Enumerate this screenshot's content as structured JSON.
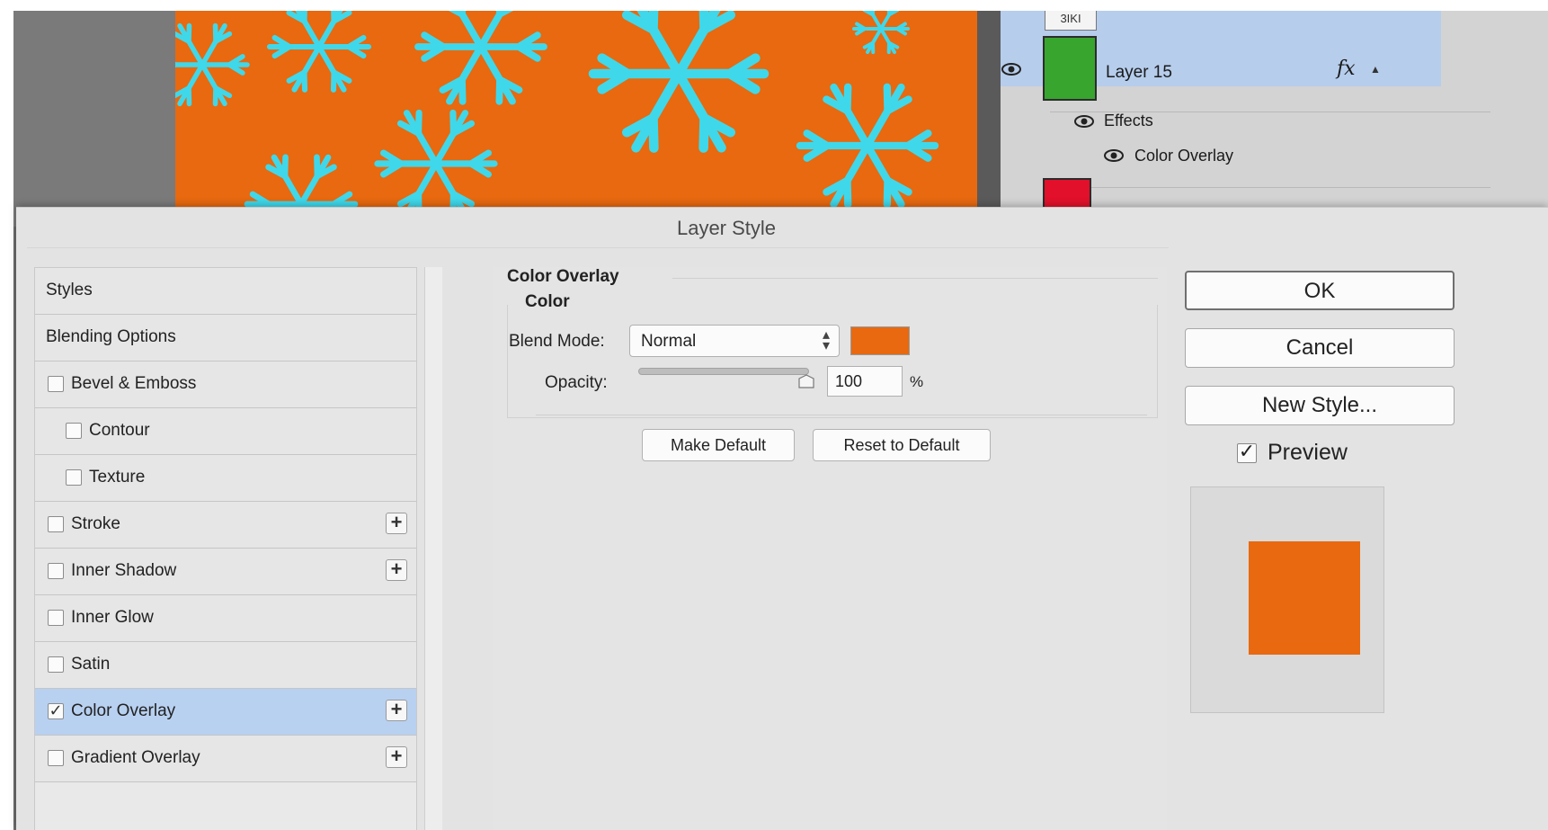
{
  "canvas": {
    "fill_color": "#e8690f",
    "snowflake_color": "#3fd8ea"
  },
  "layers_panel": {
    "top_thumb_text": "3IKI",
    "layer_name": "Layer 15",
    "layer_thumb_color": "#38a52e",
    "fx_label": "fx",
    "effects_label": "Effects",
    "effect_name": "Color Overlay",
    "next_thumb_color": "#e2102a"
  },
  "dialog": {
    "title": "Layer Style",
    "style_list": [
      {
        "label": "Styles",
        "has_checkbox": false,
        "checked": false,
        "indent": false,
        "has_plus": false,
        "selected": false
      },
      {
        "label": "Blending Options",
        "has_checkbox": false,
        "checked": false,
        "indent": false,
        "has_plus": false,
        "selected": false
      },
      {
        "label": "Bevel & Emboss",
        "has_checkbox": true,
        "checked": false,
        "indent": false,
        "has_plus": false,
        "selected": false
      },
      {
        "label": "Contour",
        "has_checkbox": true,
        "checked": false,
        "indent": true,
        "has_plus": false,
        "selected": false
      },
      {
        "label": "Texture",
        "has_checkbox": true,
        "checked": false,
        "indent": true,
        "has_plus": false,
        "selected": false
      },
      {
        "label": "Stroke",
        "has_checkbox": true,
        "checked": false,
        "indent": false,
        "has_plus": true,
        "selected": false
      },
      {
        "label": "Inner Shadow",
        "has_checkbox": true,
        "checked": false,
        "indent": false,
        "has_plus": true,
        "selected": false
      },
      {
        "label": "Inner Glow",
        "has_checkbox": true,
        "checked": false,
        "indent": false,
        "has_plus": false,
        "selected": false
      },
      {
        "label": "Satin",
        "has_checkbox": true,
        "checked": false,
        "indent": false,
        "has_plus": false,
        "selected": false
      },
      {
        "label": "Color Overlay",
        "has_checkbox": true,
        "checked": true,
        "indent": false,
        "has_plus": true,
        "selected": true
      },
      {
        "label": "Gradient Overlay",
        "has_checkbox": true,
        "checked": false,
        "indent": false,
        "has_plus": true,
        "selected": false
      }
    ],
    "settings": {
      "group_title": "Color Overlay",
      "sub_title": "Color",
      "blend_label": "Blend Mode:",
      "blend_value": "Normal",
      "overlay_color": "#e8690f",
      "opacity_label": "Opacity:",
      "opacity_value": "100",
      "opacity_unit": "%",
      "opacity_fraction": 1.0,
      "make_default": "Make Default",
      "reset_default": "Reset to Default"
    },
    "buttons": {
      "ok": "OK",
      "cancel": "Cancel",
      "new_style": "New Style..."
    },
    "preview": {
      "label": "Preview",
      "checked": true,
      "swatch_color": "#e8690f"
    }
  }
}
